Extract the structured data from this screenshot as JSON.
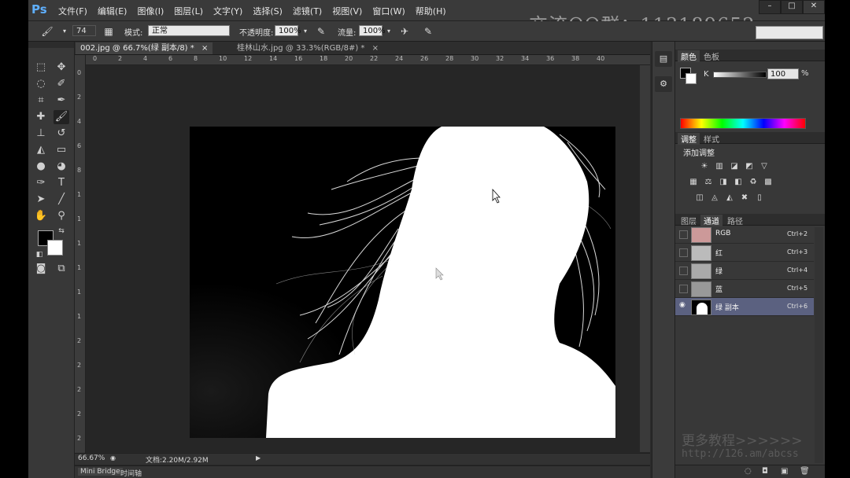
{
  "app": {
    "logo": "Ps"
  },
  "menu": [
    "文件(F)",
    "编辑(E)",
    "图像(I)",
    "图层(L)",
    "文字(Y)",
    "选择(S)",
    "滤镜(T)",
    "视图(V)",
    "窗口(W)",
    "帮助(H)"
  ],
  "overlay_text": "交流QQ群：113189652",
  "window_controls": [
    "–",
    "□",
    "✕"
  ],
  "options": {
    "brush_size": "74",
    "mode_label": "模式:",
    "mode_value": "正常",
    "opacity_label": "不透明度:",
    "opacity_value": "100%",
    "flow_label": "流量:",
    "flow_value": "100%"
  },
  "tabs": [
    {
      "label": "002.jpg @ 66.7%(绿 副本/8) *",
      "close": "×"
    },
    {
      "label": "桂林山水.jpg @ 33.3%(RGB/8#) *",
      "close": "×"
    }
  ],
  "ruler_h": [
    "0",
    "2",
    "4",
    "6",
    "8",
    "10",
    "12",
    "14",
    "16",
    "18",
    "20",
    "22",
    "24",
    "26",
    "28",
    "30",
    "32",
    "34",
    "36",
    "38",
    "40"
  ],
  "ruler_v": [
    "0",
    "2",
    "4",
    "6",
    "8",
    "1",
    "1",
    "1",
    "1",
    "1",
    "1",
    "2",
    "2",
    "2",
    "2",
    "2"
  ],
  "status": {
    "zoom": "66.67%",
    "doc": "文档:2.20M/2.92M"
  },
  "bottom_tabs": [
    "Mini Bridge",
    "时间轴"
  ],
  "color_panel": {
    "tabs": [
      "颜色",
      "色板"
    ],
    "k_label": "K",
    "k_value": "100",
    "k_unit": "%"
  },
  "adjust_panel": {
    "tabs": [
      "调整",
      "样式"
    ],
    "title": "添加调整"
  },
  "layers_panel": {
    "tabs": [
      "图层",
      "通道",
      "路径"
    ]
  },
  "channels": [
    {
      "name": "RGB",
      "shortcut": "Ctrl+2",
      "selected": false
    },
    {
      "name": "红",
      "shortcut": "Ctrl+3",
      "selected": false
    },
    {
      "name": "绿",
      "shortcut": "Ctrl+4",
      "selected": false
    },
    {
      "name": "蓝",
      "shortcut": "Ctrl+5",
      "selected": false
    },
    {
      "name": "绿 副本",
      "shortcut": "Ctrl+6",
      "selected": true
    }
  ],
  "watermark": {
    "line1": "更多教程>>>>>>",
    "line2": "http://126.am/abcss"
  },
  "icons": {
    "brush": "brush-icon",
    "eye": "eye-icon",
    "cursor": "cursor-icon"
  }
}
